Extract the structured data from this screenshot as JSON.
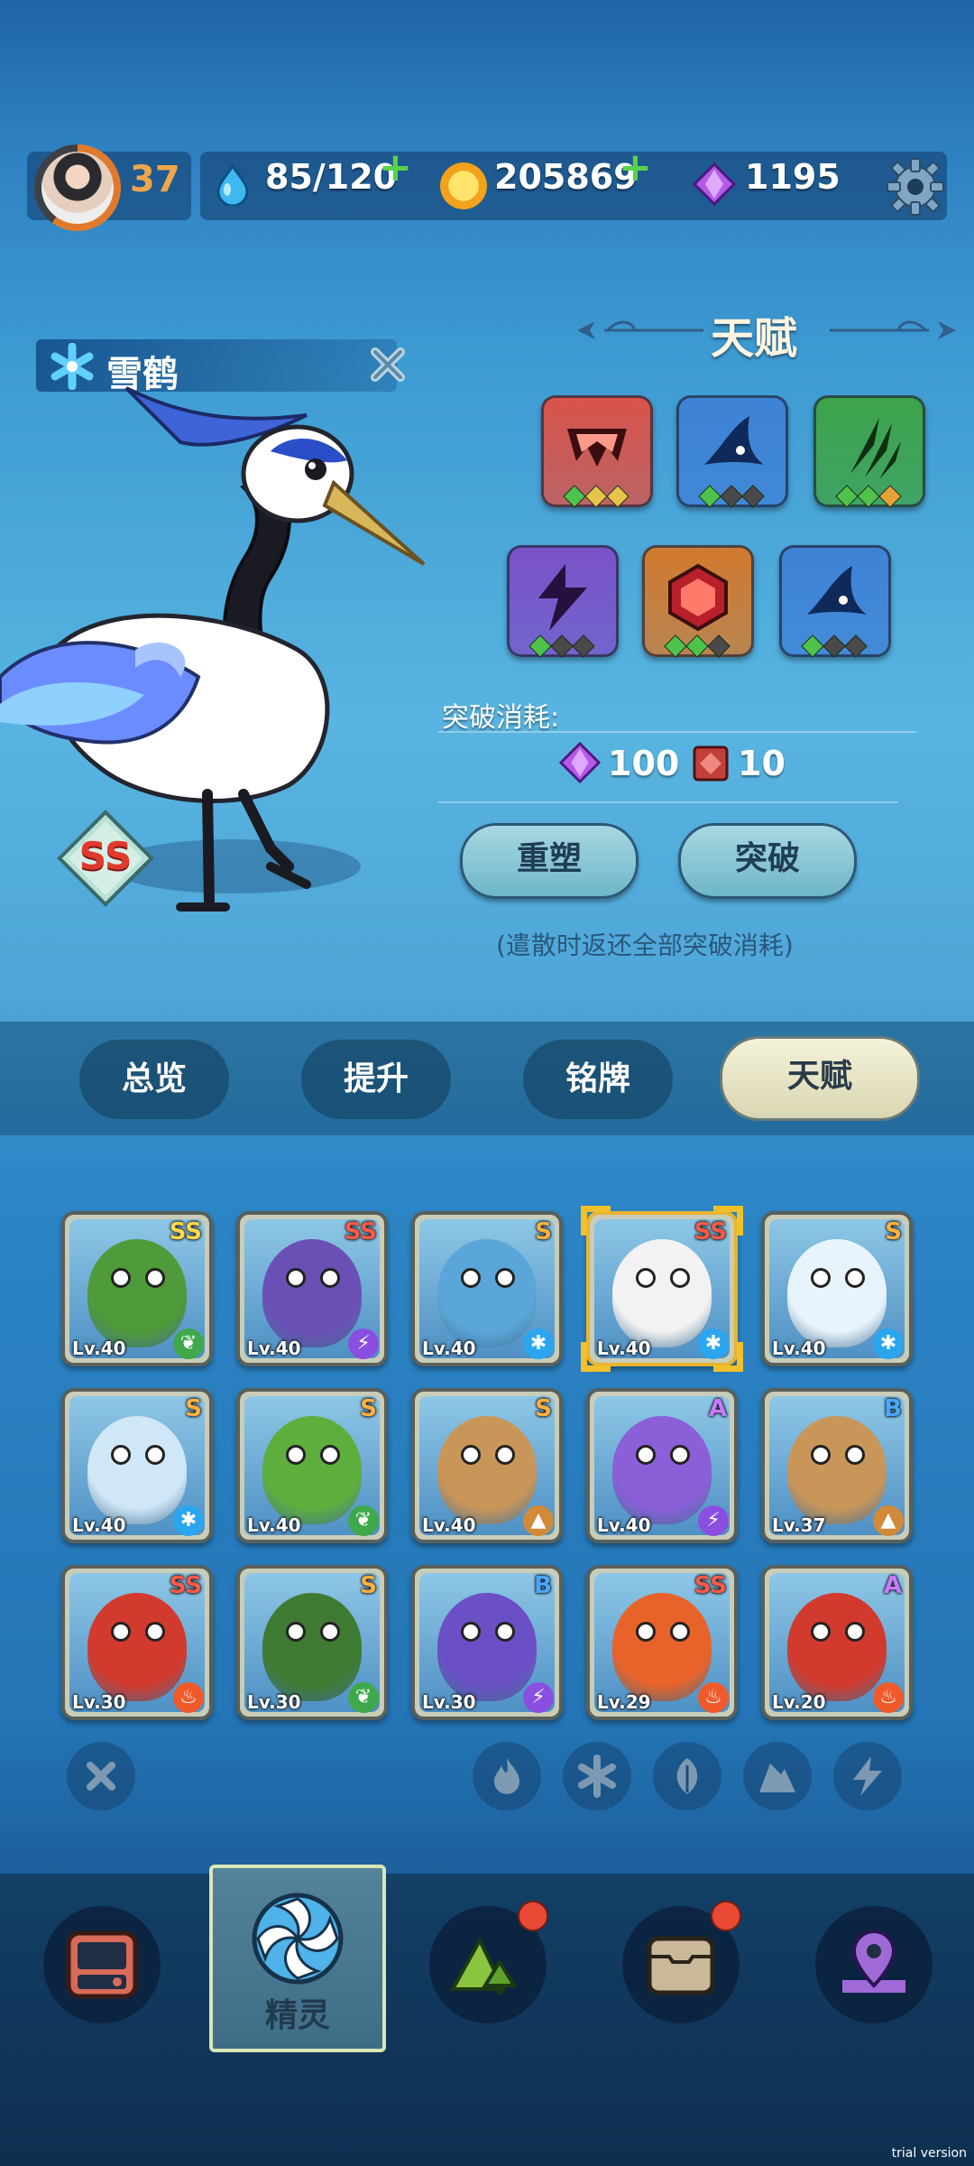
{
  "topbar": {
    "player_level": "37",
    "energy": "85/120",
    "coins": "205869",
    "gems": "1195"
  },
  "creature": {
    "name": "雪鹤",
    "grade": "SS",
    "element": "ice"
  },
  "talent": {
    "title": "天赋",
    "slots": [
      {
        "icon": "fang-icon",
        "color": "#d9534a",
        "pips": [
          "#4ec24a",
          "#e6c34a",
          "#e6c34a"
        ]
      },
      {
        "icon": "fin-icon",
        "color": "#3f82d6",
        "pips": [
          "#4ec24a",
          "#4a4a4a",
          "#4a4a4a"
        ]
      },
      {
        "icon": "claw-icon",
        "color": "#3ea34a",
        "pips": [
          "#4ec24a",
          "#4ec24a",
          "#e6a23a"
        ]
      },
      {
        "icon": "lightning-icon",
        "color": "#7a52c8",
        "pips": [
          "#4ec24a",
          "#4a4a4a",
          "#4a4a4a"
        ]
      },
      {
        "icon": "gem-hex-icon",
        "color": "#d27a2e",
        "pips": [
          "#4ec24a",
          "#4ec24a",
          "#4a4a4a"
        ]
      },
      {
        "icon": "fin-icon",
        "color": "#3f82d6",
        "pips": [
          "#4ec24a",
          "#4a4a4a",
          "#4a4a4a"
        ]
      }
    ],
    "cost_title": "突破消耗:",
    "cost_gems": "100",
    "cost_books": "10",
    "reshape_label": "重塑",
    "breakthrough_label": "突破",
    "note": "(遣散时返还全部突破消耗)"
  },
  "tabs": [
    "总览",
    "提升",
    "铭牌",
    "天赋"
  ],
  "roster": [
    {
      "rank": "SS",
      "rank_color": "rainbow",
      "level": "Lv.40",
      "element": "leaf",
      "body": "#4f9a3a"
    },
    {
      "rank": "SS",
      "rank_color": "#ff5a4a",
      "level": "Lv.40",
      "element": "lightning",
      "body": "#6a4fb5"
    },
    {
      "rank": "S",
      "rank_color": "#ffb040",
      "level": "Lv.40",
      "element": "ice",
      "body": "#5aa6d8"
    },
    {
      "rank": "SS",
      "rank_color": "#ff5a4a",
      "level": "Lv.40",
      "element": "ice",
      "body": "#f2f2f2",
      "selected": true
    },
    {
      "rank": "S",
      "rank_color": "#ffb040",
      "level": "Lv.40",
      "element": "ice",
      "body": "#e8f4fb"
    },
    {
      "rank": "S",
      "rank_color": "#ffb040",
      "level": "Lv.40",
      "element": "ice",
      "body": "#cfe7f7"
    },
    {
      "rank": "S",
      "rank_color": "#ffb040",
      "level": "Lv.40",
      "element": "leaf",
      "body": "#5eae3e"
    },
    {
      "rank": "S",
      "rank_color": "#ffb040",
      "level": "Lv.40",
      "element": "earth",
      "body": "#c9965a"
    },
    {
      "rank": "A",
      "rank_color": "#c77bff",
      "level": "Lv.40",
      "element": "lightning",
      "body": "#8a5fd8"
    },
    {
      "rank": "B",
      "rank_color": "#4aa8ff",
      "level": "Lv.37",
      "element": "earth",
      "body": "#c9965a"
    },
    {
      "rank": "SS",
      "rank_color": "#ff5a4a",
      "level": "Lv.30",
      "element": "fire",
      "body": "#d23a2e"
    },
    {
      "rank": "S",
      "rank_color": "#ffb040",
      "level": "Lv.30",
      "element": "leaf",
      "body": "#3f7a32"
    },
    {
      "rank": "B",
      "rank_color": "#4aa8ff",
      "level": "Lv.30",
      "element": "lightning",
      "body": "#6a50c4"
    },
    {
      "rank": "SS",
      "rank_color": "#ff5a4a",
      "level": "Lv.29",
      "element": "fire",
      "body": "#e8632a"
    },
    {
      "rank": "A",
      "rank_color": "#c77bff",
      "level": "Lv.20",
      "element": "fire",
      "body": "#d23a2e"
    }
  ],
  "filters": [
    "close-icon",
    "fire-icon",
    "ice-icon",
    "leaf-icon",
    "earth-icon",
    "lightning-icon"
  ],
  "bottomnav": {
    "items": [
      "backpack-icon",
      "spirit-icon",
      "mountain-icon",
      "chest-icon",
      "map-pin-icon"
    ],
    "active_label": "精灵"
  },
  "watermark": "trial version"
}
